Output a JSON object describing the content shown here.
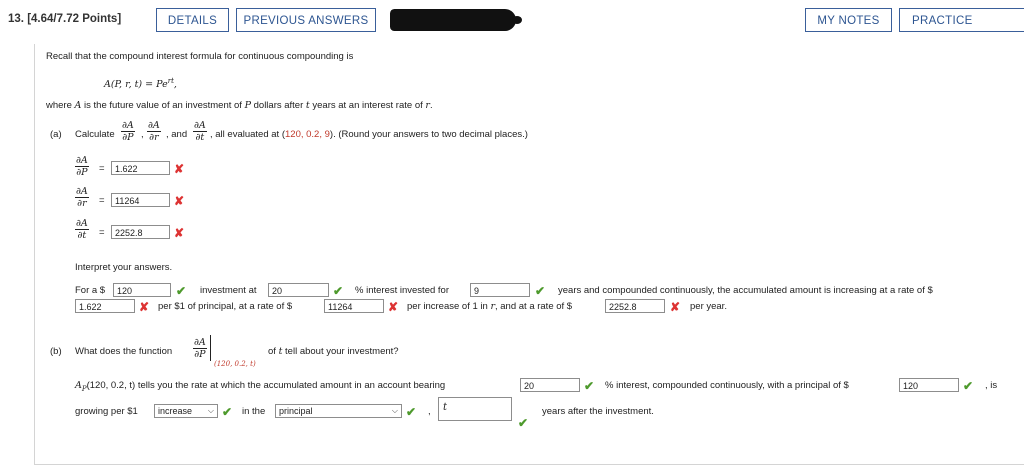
{
  "header": {
    "question_number": "13.",
    "points": "[4.64/7.72 Points]",
    "details_label": "DETAILS",
    "previous_answers_label": "PREVIOUS ANSWERS",
    "my_notes_label": "MY NOTES",
    "practice_label": "PRACTICE ANOTHER"
  },
  "intro": {
    "line1": "Recall that the compound interest formula for continuous compounding is",
    "formula_lhs": "A(P, r, t) = Pe",
    "formula_exp": "rt",
    "formula_end": ",",
    "line2_a": "where ",
    "line2_A": "A",
    "line2_b": " is the future value of an investment of ",
    "line2_P": "P",
    "line2_c": " dollars after ",
    "line2_t": "t",
    "line2_d": " years at an interest rate of ",
    "line2_r": "r",
    "line2_e": "."
  },
  "part_a": {
    "label": "(a)",
    "calculate": "Calculate",
    "and": ", and",
    "comma": ",",
    "evaluated_pre": ", all evaluated at (",
    "point": "120, 0.2, 9",
    "evaluated_post": "). (Round your answers to two decimal places.)",
    "d": "∂A",
    "dP": "∂P",
    "dr": "∂r",
    "dt": "∂t",
    "equals": "=",
    "ans_P": "1.622",
    "ans_r": "11264",
    "ans_t": "2252.8",
    "interpret": "Interpret your answers.",
    "for_a": "For a $",
    "val_120": "120",
    "invest_at": "investment at",
    "val_20": "20",
    "pct_interest": "% interest invested for",
    "val_9": "9",
    "years_and": "years and compounded continuously, the accumulated amount is increasing at a rate of $",
    "val_1622": "1.622",
    "per_dollar": "per $1 of principal, at a rate of $",
    "val_11264": "11264",
    "per_increase": "per increase of 1 in",
    "r_var": "r",
    "and_rate": ", and at a rate of $",
    "val_22528": "2252.8",
    "per_year": "per year."
  },
  "part_b": {
    "label": "(b)",
    "what_does": "What does the function",
    "eval_at": "(120, 0.2, t)",
    "tell_pre": "of",
    "tell_t": "t",
    "tell_post": "tell about your investment?",
    "ap_lead": "A",
    "ap_sub": "P",
    "ap_args": "(120, 0.2, t) tells you the rate at which the accumulated amount in an account bearing",
    "val_20": "20",
    "pct_text": "% interest, compounded continuously, with a principal of $",
    "val_120": "120",
    "is": ", is",
    "growing": "growing per $1",
    "select1": "increase",
    "in_the": "in the",
    "select2": "principal",
    "comma": ",",
    "t_answer": "t",
    "years_after": "years after the investment."
  },
  "colors": {
    "correct": "#4e9a2d",
    "incorrect": "#dd3333",
    "button_border": "#3a5f9a"
  }
}
